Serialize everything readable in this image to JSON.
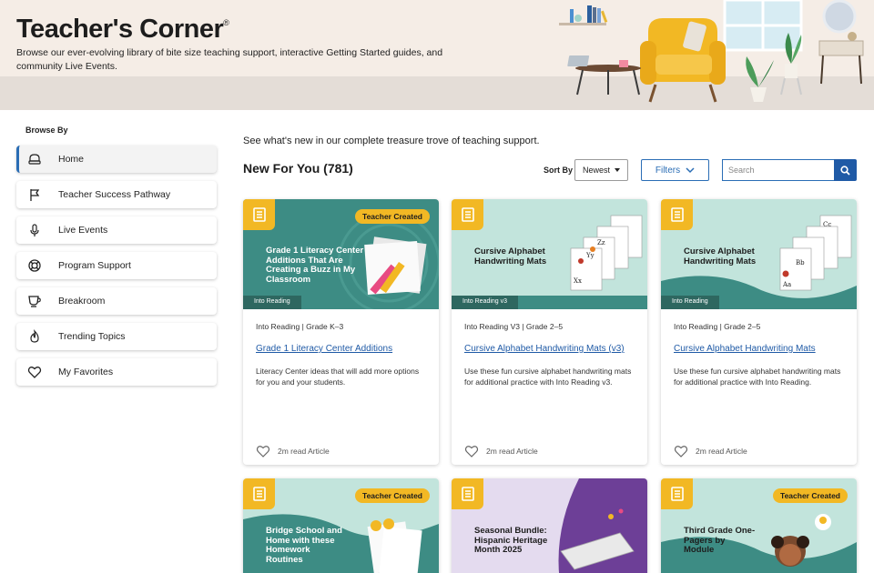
{
  "header": {
    "title": "Teacher's Corner",
    "trademark": "®",
    "subtitle": "Browse our ever-evolving library of bite size teaching support, interactive Getting Started guides, and community Live Events."
  },
  "sidebar": {
    "label": "Browse By",
    "items": [
      {
        "label": "Home",
        "icon": "home-icon"
      },
      {
        "label": "Teacher Success Pathway",
        "icon": "flag-icon"
      },
      {
        "label": "Live Events",
        "icon": "microphone-icon"
      },
      {
        "label": "Program Support",
        "icon": "lifebuoy-icon"
      },
      {
        "label": "Breakroom",
        "icon": "coffee-cup-icon"
      },
      {
        "label": "Trending Topics",
        "icon": "flame-icon"
      },
      {
        "label": "My Favorites",
        "icon": "heart-icon"
      }
    ]
  },
  "main": {
    "intro": "See what's new in our complete treasure trove of teaching support.",
    "section_title": "New For You (781)",
    "sort": {
      "label": "Sort By",
      "value": "Newest"
    },
    "filters_label": "Filters",
    "search_placeholder": "Search"
  },
  "cards": [
    {
      "image_title": "Grade 1 Literacy Center Additions That Are Creating a Buzz in My Classroom",
      "badge": "Teacher Created",
      "series": "Into Reading",
      "meta": "Into Reading  |  Grade K–3",
      "link": "Grade 1 Literacy Center Additions",
      "desc": "Literacy Center ideas that will add more options for you and your students.",
      "read": "2m read Article"
    },
    {
      "image_title": "Cursive Alphabet Handwriting Mats",
      "series": "Into Reading v3",
      "meta": "Into Reading V3  |  Grade 2–5",
      "link": "Cursive Alphabet Handwriting Mats (v3)",
      "desc": "Use these fun cursive alphabet handwriting mats for additional practice with Into Reading v3.",
      "read": "2m read Article"
    },
    {
      "image_title": "Cursive Alphabet Handwriting Mats",
      "series": "Into Reading",
      "meta": "Into Reading  |  Grade 2–5",
      "link": "Cursive Alphabet Handwriting Mats",
      "desc": "Use these fun cursive alphabet handwriting mats for additional practice with Into Reading.",
      "read": "2m read Article"
    },
    {
      "image_title": "Bridge School and Home with these Homework Routines",
      "badge": "Teacher Created"
    },
    {
      "image_title": "Seasonal Bundle: Hispanic Heritage Month 2025"
    },
    {
      "image_title": "Third Grade One-Pagers by Module",
      "badge": "Teacher Created"
    }
  ],
  "colors": {
    "accent_blue": "#1f5aa6",
    "badge_yellow": "#f2b824",
    "teal_card": "#3d8c84",
    "light_teal": "#bfe3dc",
    "purple": "#6d3f97"
  }
}
